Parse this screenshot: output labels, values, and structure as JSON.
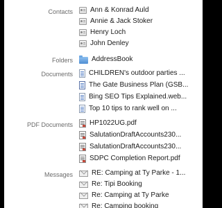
{
  "sections": [
    {
      "label": "Contacts",
      "icon": "contact-card-icon",
      "items": [
        "Ann & Konrad Auld",
        "Annie & Jack Stoker",
        "Henry Loch",
        "John Denley"
      ]
    },
    {
      "label": "Folders",
      "icon": "folder-icon",
      "items": [
        "AddressBook"
      ]
    },
    {
      "label": "Documents",
      "icon": "document-icon",
      "items": [
        "CHILDREN's outdoor parties ...",
        "The Gate Business Plan (GSB...",
        "Bing SEO Tips Explained.web...",
        "Top 10 tips to rank well on ..."
      ]
    },
    {
      "label": "PDF Documents",
      "icon": "pdf-icon",
      "items": [
        "HP1022UG.pdf",
        "SalutationDraftAccounts230...",
        "SalutationDraftAccounts230...",
        "SDPC Completion Report.pdf"
      ]
    },
    {
      "label": "Messages",
      "icon": "mail-icon",
      "items": [
        "RE: Camping at Ty Parke - 1...",
        "Re: Tipi Booking",
        "Re: Camping at Ty Parke",
        "Re: Camping booking"
      ]
    }
  ]
}
